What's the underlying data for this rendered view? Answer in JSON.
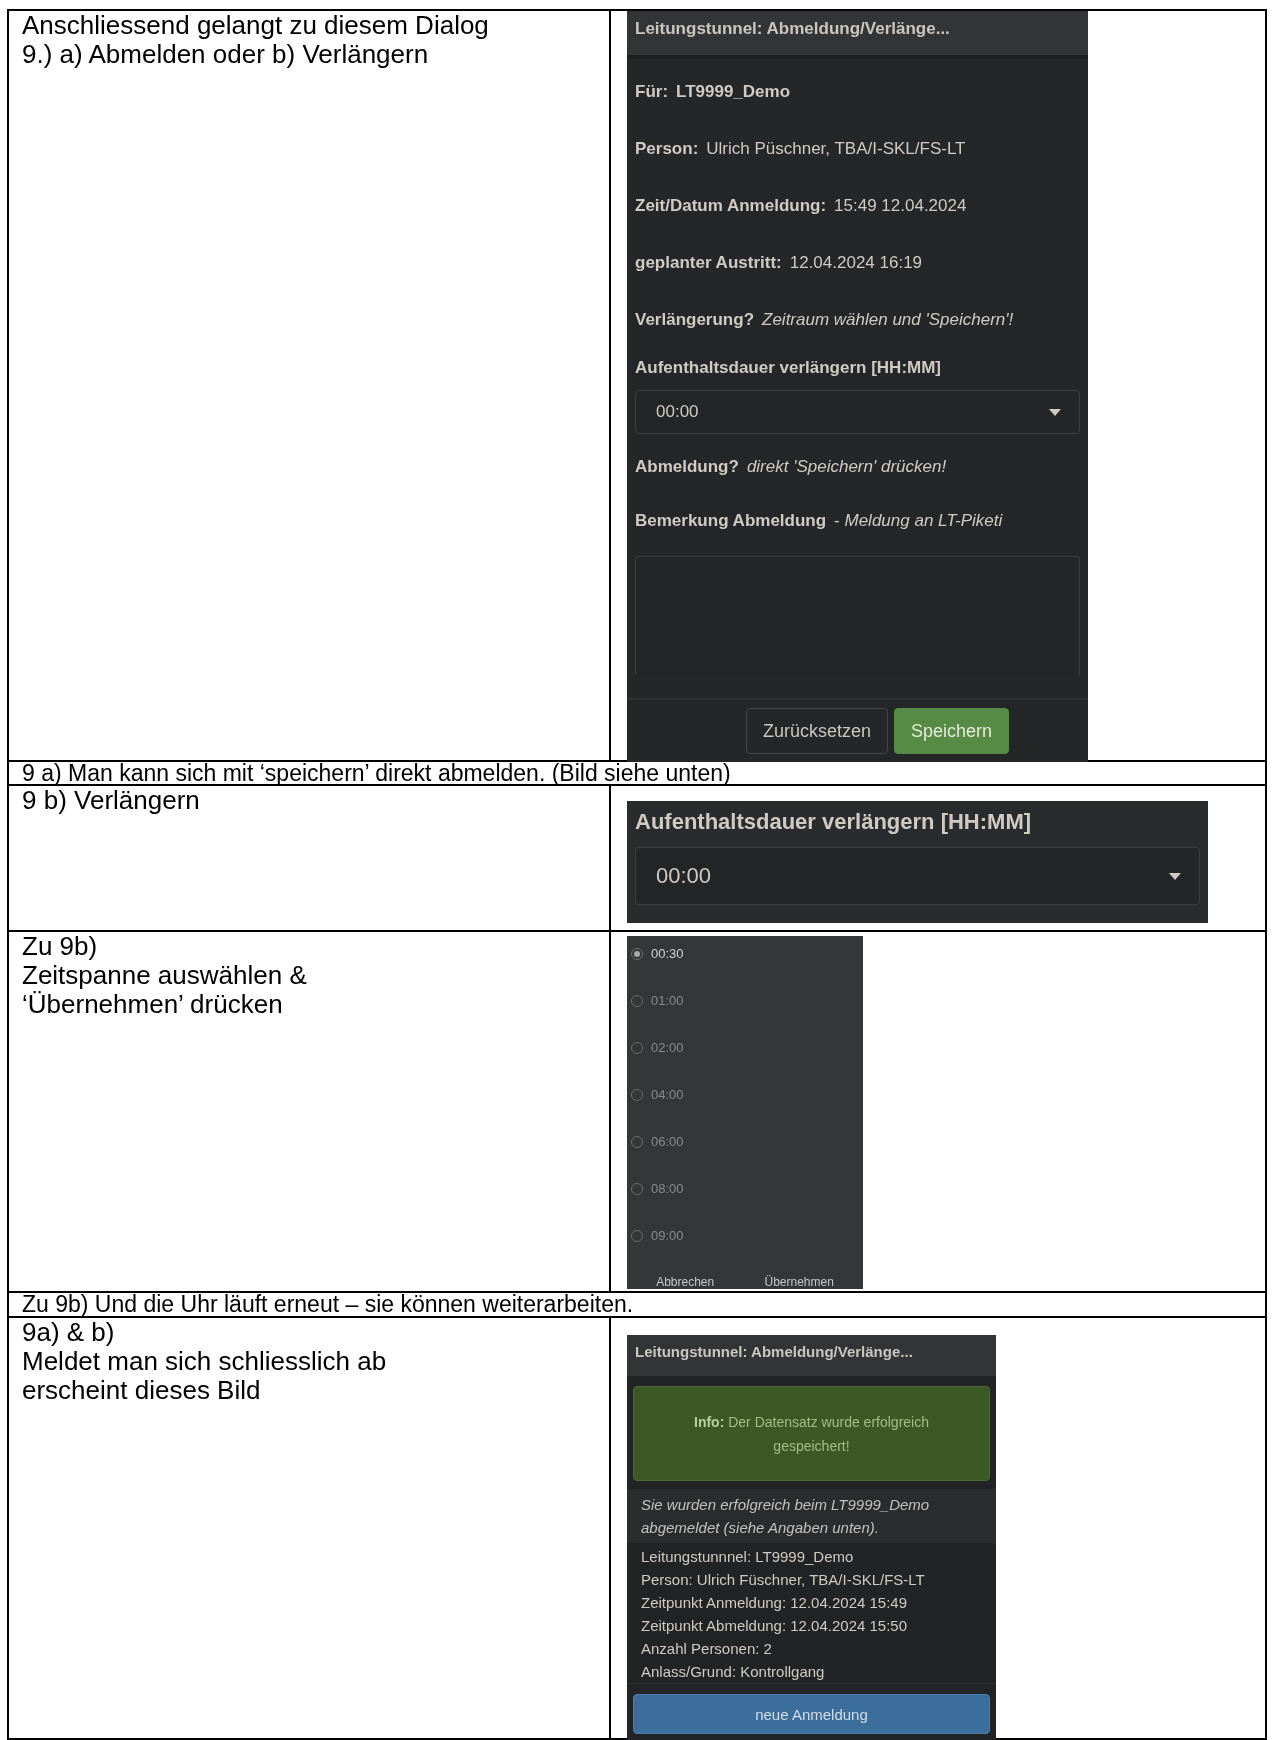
{
  "intro": {
    "lines": [
      "Anschliessend gelangt zu diesem Dialog",
      "9.) a) Abmelden oder b) Verlängern"
    ]
  },
  "dialog": {
    "title": "Leitungstunnel: Abmeldung/Verlänge...",
    "info": [
      {
        "label": "Für:",
        "value": "**LT9999_Demo**"
      },
      {
        "label": "Person:",
        "value": "Ulrich Püschner, TBA/I-SKL/FS-LT"
      },
      {
        "label": "Zeit/Datum Anmeldung:",
        "value": "15:49 12.04.2024"
      },
      {
        "label": "geplanter Austritt:",
        "value": "12.04.2024 16:19"
      },
      {
        "label": "Verlängerung?",
        "value": "*Zeitraum wählen und 'Speichern'!*"
      }
    ],
    "select_label": "Aufenthaltsdauer verlängern [HH:MM]",
    "select_value": "00:00",
    "hints": [
      {
        "label": "Abmeldung?",
        "value": "*direkt 'Speichern' drücken!*"
      },
      {
        "label": "Bemerkung Abmeldung",
        "value": "- *Meldung an LT-Piketi*"
      }
    ],
    "buttons": [
      {
        "label": "Zurücksetzen",
        "kind": "secondary"
      },
      {
        "label": "Speichern",
        "kind": "primary"
      }
    ]
  },
  "note_9a": "9 a) Man kann sich mit ‘speichern’ direkt abmelden. (Bild siehe unten)",
  "extend": {
    "lines": [
      "9 b) Verlängern"
    ],
    "select_label": "Aufenthaltsdauer verlängern [HH:MM]",
    "select_value": "00:00"
  },
  "picker": {
    "lines": [
      "Zu 9b)",
      "Zeitspanne auswählen &",
      "‘Übernehmen’ drücken"
    ],
    "options": [
      {
        "label": "00:30",
        "selected": true
      },
      {
        "label": "01:00",
        "selected": false
      },
      {
        "label": "02:00",
        "selected": false
      },
      {
        "label": "04:00",
        "selected": false
      },
      {
        "label": "06:00",
        "selected": false
      },
      {
        "label": "08:00",
        "selected": false
      },
      {
        "label": "09:00",
        "selected": false
      }
    ],
    "buttons": [
      "Abbrechen",
      "Übernehmen"
    ]
  },
  "note_clock": "Zu 9b) Und die Uhr läuft erneut – sie können weiterarbeiten.",
  "result": {
    "lines": [
      "9a) & b)",
      "Meldet man sich schliesslich ab",
      "erscheint dieses Bild"
    ],
    "title": "Leitungstunnel: Abmeldung/Verlänge...",
    "alert": "**Info:** Der Datensatz wurde erfolgreich gespeichert!",
    "message": "Sie wurden erfolgreich beim LT9999_Demo abgemeldet (siehe Angaben unten).",
    "details": [
      "Leitungstunnnel: LT9999_Demo",
      "Person: Ulrich Füschner, TBA/I-SKL/FS-LT",
      "Zeitpunkt Anmeldung: 12.04.2024 15:49",
      "Zeitpunkt Abmeldung: 12.04.2024 15:50",
      "Anzahl Personen: 2",
      "Anlass/Grund: Kontrollgang"
    ],
    "button": "neue Anmeldung"
  }
}
